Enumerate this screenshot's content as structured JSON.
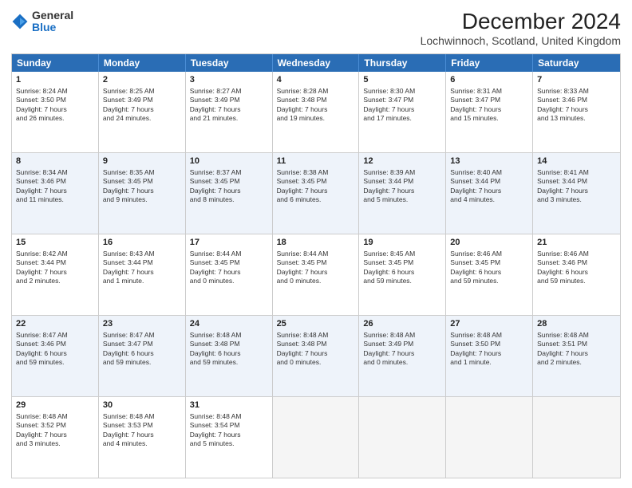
{
  "header": {
    "logo_general": "General",
    "logo_blue": "Blue",
    "month_title": "December 2024",
    "location": "Lochwinnoch, Scotland, United Kingdom"
  },
  "calendar": {
    "weekdays": [
      "Sunday",
      "Monday",
      "Tuesday",
      "Wednesday",
      "Thursday",
      "Friday",
      "Saturday"
    ],
    "rows": [
      [
        {
          "day": "1",
          "info": "Sunrise: 8:24 AM\nSunset: 3:50 PM\nDaylight: 7 hours\nand 26 minutes."
        },
        {
          "day": "2",
          "info": "Sunrise: 8:25 AM\nSunset: 3:49 PM\nDaylight: 7 hours\nand 24 minutes."
        },
        {
          "day": "3",
          "info": "Sunrise: 8:27 AM\nSunset: 3:49 PM\nDaylight: 7 hours\nand 21 minutes."
        },
        {
          "day": "4",
          "info": "Sunrise: 8:28 AM\nSunset: 3:48 PM\nDaylight: 7 hours\nand 19 minutes."
        },
        {
          "day": "5",
          "info": "Sunrise: 8:30 AM\nSunset: 3:47 PM\nDaylight: 7 hours\nand 17 minutes."
        },
        {
          "day": "6",
          "info": "Sunrise: 8:31 AM\nSunset: 3:47 PM\nDaylight: 7 hours\nand 15 minutes."
        },
        {
          "day": "7",
          "info": "Sunrise: 8:33 AM\nSunset: 3:46 PM\nDaylight: 7 hours\nand 13 minutes."
        }
      ],
      [
        {
          "day": "8",
          "info": "Sunrise: 8:34 AM\nSunset: 3:46 PM\nDaylight: 7 hours\nand 11 minutes."
        },
        {
          "day": "9",
          "info": "Sunrise: 8:35 AM\nSunset: 3:45 PM\nDaylight: 7 hours\nand 9 minutes."
        },
        {
          "day": "10",
          "info": "Sunrise: 8:37 AM\nSunset: 3:45 PM\nDaylight: 7 hours\nand 8 minutes."
        },
        {
          "day": "11",
          "info": "Sunrise: 8:38 AM\nSunset: 3:45 PM\nDaylight: 7 hours\nand 6 minutes."
        },
        {
          "day": "12",
          "info": "Sunrise: 8:39 AM\nSunset: 3:44 PM\nDaylight: 7 hours\nand 5 minutes."
        },
        {
          "day": "13",
          "info": "Sunrise: 8:40 AM\nSunset: 3:44 PM\nDaylight: 7 hours\nand 4 minutes."
        },
        {
          "day": "14",
          "info": "Sunrise: 8:41 AM\nSunset: 3:44 PM\nDaylight: 7 hours\nand 3 minutes."
        }
      ],
      [
        {
          "day": "15",
          "info": "Sunrise: 8:42 AM\nSunset: 3:44 PM\nDaylight: 7 hours\nand 2 minutes."
        },
        {
          "day": "16",
          "info": "Sunrise: 8:43 AM\nSunset: 3:44 PM\nDaylight: 7 hours\nand 1 minute."
        },
        {
          "day": "17",
          "info": "Sunrise: 8:44 AM\nSunset: 3:45 PM\nDaylight: 7 hours\nand 0 minutes."
        },
        {
          "day": "18",
          "info": "Sunrise: 8:44 AM\nSunset: 3:45 PM\nDaylight: 7 hours\nand 0 minutes."
        },
        {
          "day": "19",
          "info": "Sunrise: 8:45 AM\nSunset: 3:45 PM\nDaylight: 6 hours\nand 59 minutes."
        },
        {
          "day": "20",
          "info": "Sunrise: 8:46 AM\nSunset: 3:45 PM\nDaylight: 6 hours\nand 59 minutes."
        },
        {
          "day": "21",
          "info": "Sunrise: 8:46 AM\nSunset: 3:46 PM\nDaylight: 6 hours\nand 59 minutes."
        }
      ],
      [
        {
          "day": "22",
          "info": "Sunrise: 8:47 AM\nSunset: 3:46 PM\nDaylight: 6 hours\nand 59 minutes."
        },
        {
          "day": "23",
          "info": "Sunrise: 8:47 AM\nSunset: 3:47 PM\nDaylight: 6 hours\nand 59 minutes."
        },
        {
          "day": "24",
          "info": "Sunrise: 8:48 AM\nSunset: 3:48 PM\nDaylight: 6 hours\nand 59 minutes."
        },
        {
          "day": "25",
          "info": "Sunrise: 8:48 AM\nSunset: 3:48 PM\nDaylight: 7 hours\nand 0 minutes."
        },
        {
          "day": "26",
          "info": "Sunrise: 8:48 AM\nSunset: 3:49 PM\nDaylight: 7 hours\nand 0 minutes."
        },
        {
          "day": "27",
          "info": "Sunrise: 8:48 AM\nSunset: 3:50 PM\nDaylight: 7 hours\nand 1 minute."
        },
        {
          "day": "28",
          "info": "Sunrise: 8:48 AM\nSunset: 3:51 PM\nDaylight: 7 hours\nand 2 minutes."
        }
      ],
      [
        {
          "day": "29",
          "info": "Sunrise: 8:48 AM\nSunset: 3:52 PM\nDaylight: 7 hours\nand 3 minutes."
        },
        {
          "day": "30",
          "info": "Sunrise: 8:48 AM\nSunset: 3:53 PM\nDaylight: 7 hours\nand 4 minutes."
        },
        {
          "day": "31",
          "info": "Sunrise: 8:48 AM\nSunset: 3:54 PM\nDaylight: 7 hours\nand 5 minutes."
        },
        {
          "day": "",
          "info": ""
        },
        {
          "day": "",
          "info": ""
        },
        {
          "day": "",
          "info": ""
        },
        {
          "day": "",
          "info": ""
        }
      ]
    ]
  }
}
